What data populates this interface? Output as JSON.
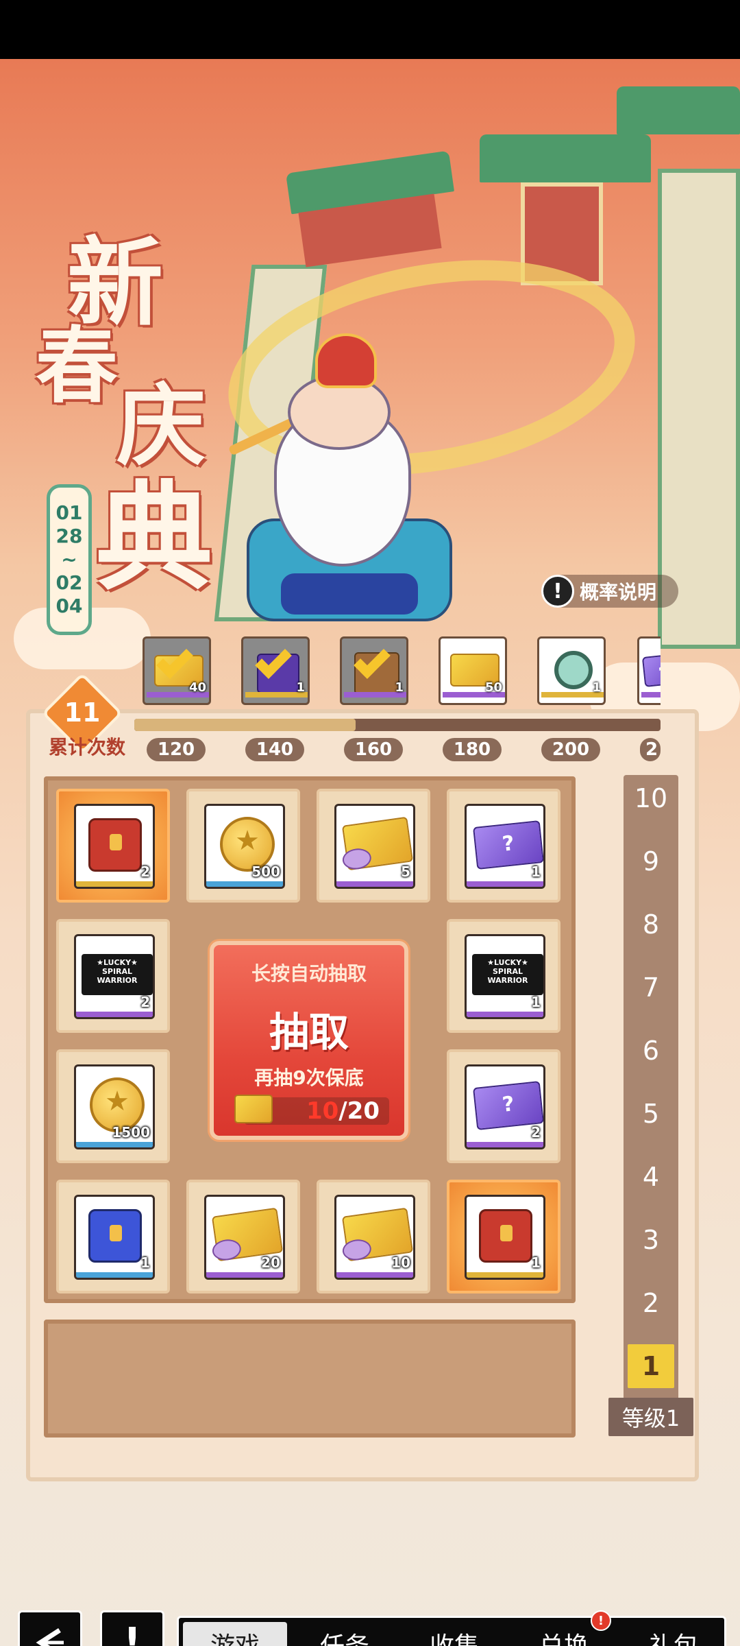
{
  "banner": {
    "title_chars": [
      "新",
      "春",
      "庆",
      "典"
    ],
    "date_parts": [
      "01",
      "28",
      "~",
      "02",
      "04"
    ],
    "probability_label": "概率说明"
  },
  "milestones": {
    "items": [
      {
        "count": "40",
        "claimed": true,
        "bar": "purple",
        "icon": "chest-icon"
      },
      {
        "count": "1",
        "claimed": true,
        "bar": "gold",
        "icon": "gift-box-icon"
      },
      {
        "count": "1",
        "claimed": true,
        "bar": "purple",
        "icon": "crate-icon"
      },
      {
        "count": "50",
        "claimed": false,
        "bar": "purple",
        "icon": "golden-ticket-icon"
      },
      {
        "count": "1",
        "claimed": false,
        "bar": "gold",
        "icon": "gear-core-icon"
      }
    ],
    "ticks": [
      "120",
      "140",
      "160",
      "180",
      "200",
      "2"
    ],
    "progress_fraction": 0.42
  },
  "draw_count": {
    "value": "11",
    "label": "累计次数"
  },
  "grid": {
    "cells": [
      {
        "qty": "2",
        "type": "red-chest",
        "highlight": true,
        "bar": "#e0b43a"
      },
      {
        "qty": "500",
        "type": "coin",
        "highlight": false,
        "bar": "#4aa3d8"
      },
      {
        "qty": "5",
        "type": "gold-ticket",
        "highlight": false,
        "bar": "#9b5ed1"
      },
      {
        "qty": "1",
        "type": "purple-ticket",
        "highlight": false,
        "bar": "#9b5ed1"
      },
      {
        "qty": "2",
        "type": "lucky",
        "highlight": false,
        "bar": "#9b5ed1"
      },
      {
        "qty": "1",
        "type": "lucky",
        "highlight": false,
        "bar": "#9b5ed1"
      },
      {
        "qty": "1500",
        "type": "coin",
        "highlight": false,
        "bar": "#4aa3d8"
      },
      {
        "qty": "2",
        "type": "purple-ticket",
        "highlight": false,
        "bar": "#9b5ed1"
      },
      {
        "qty": "1",
        "type": "blue-chest",
        "highlight": false,
        "bar": "#4aa3d8"
      },
      {
        "qty": "20",
        "type": "gold-ticket",
        "highlight": false,
        "bar": "#9b5ed1"
      },
      {
        "qty": "10",
        "type": "gold-ticket",
        "highlight": false,
        "bar": "#9b5ed1"
      },
      {
        "qty": "1",
        "type": "red-chest",
        "highlight": true,
        "bar": "#e0b43a"
      }
    ],
    "lucky_text": "LUCKY SPIRAL WARRIOR"
  },
  "draw_button": {
    "hint": "长按自动抽取",
    "label": "抽取",
    "guarantee": "再抽9次保底",
    "progress_current": "10",
    "progress_total": "/20"
  },
  "levels": {
    "values": [
      "10",
      "9",
      "8",
      "7",
      "6",
      "5",
      "4",
      "3",
      "2",
      "1"
    ],
    "current": "1",
    "label": "等级1"
  },
  "bottom_nav": {
    "back_icon": "back-arrow-icon",
    "info_icon": "exclamation-icon",
    "tabs": [
      "游戏",
      "任务",
      "收集",
      "兑换",
      "礼包"
    ],
    "active_tab": "游戏",
    "badge_tab": "兑换"
  }
}
